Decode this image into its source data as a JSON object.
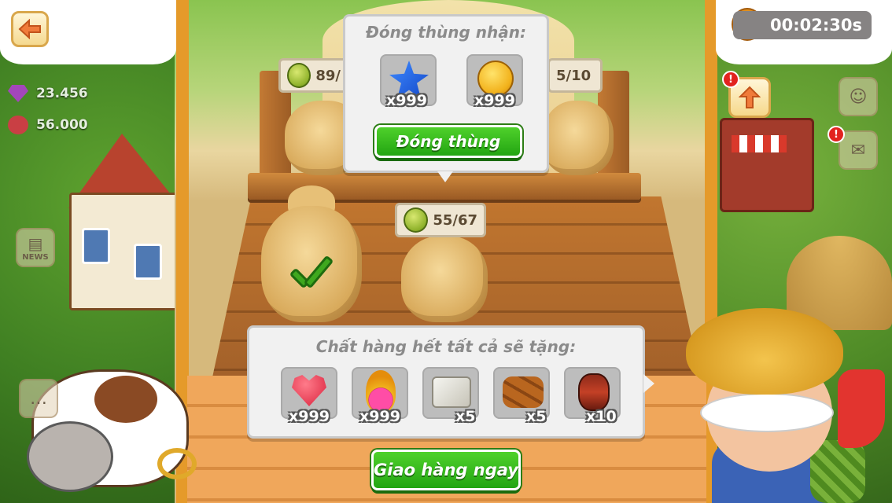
{
  "top": {
    "timer": "00:02:30s",
    "resources": [
      {
        "icon": "gem-icon",
        "value": "23.456"
      },
      {
        "icon": "heart-icon",
        "value": "56.000"
      }
    ],
    "news_label": "NEWS"
  },
  "truck": {
    "slots": [
      {
        "item": "melon",
        "progress": "89/"
      },
      {
        "item": "melon",
        "progress": "55/67"
      },
      {
        "item": "melon",
        "progress": "5/10"
      }
    ]
  },
  "crate_popup": {
    "title": "Đóng thùng nhận:",
    "rewards": [
      {
        "icon": "blue-star-icon",
        "qty": "x999"
      },
      {
        "icon": "gold-coin-icon",
        "qty": "x999"
      }
    ],
    "button_label": "Đóng thùng"
  },
  "bonus_popup": {
    "title": "Chất hàng hết tất cả sẽ tặng:",
    "rewards": [
      {
        "icon": "heart-icon",
        "qty": "x999"
      },
      {
        "icon": "potion-icon",
        "qty": "x999"
      },
      {
        "icon": "stone-icon",
        "qty": "x5"
      },
      {
        "icon": "wood-icon",
        "qty": "x5"
      },
      {
        "icon": "drum-icon",
        "qty": "x10"
      }
    ]
  },
  "deliver_button": "Giao hàng ngay",
  "colors": {
    "primary_green": "#23a512",
    "truck_orange": "#e59a2a",
    "panel_bg": "#f1f1f1",
    "alert_red": "#e2231f"
  }
}
